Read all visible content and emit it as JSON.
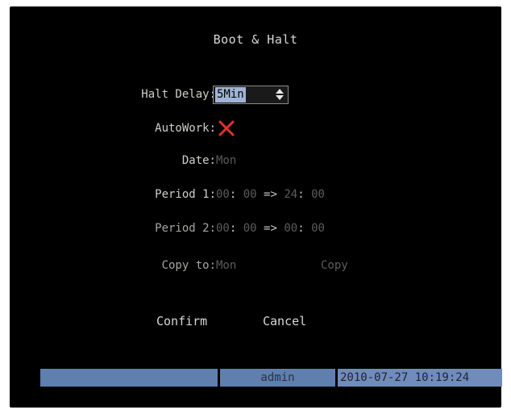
{
  "dialog": {
    "title": "Boot & Halt"
  },
  "fields": {
    "halt_delay": {
      "label": "Halt Delay:",
      "value": "5Min"
    },
    "autowork": {
      "label": "AutoWork:",
      "icon": "cross-icon",
      "color": "#e0322d"
    },
    "date": {
      "label": "Date:",
      "value": "Mon"
    },
    "period1": {
      "label": "Period 1:",
      "start_h": "00",
      "start_m": "00",
      "arrow": "=>",
      "end_h": "24",
      "end_m": "00"
    },
    "period2": {
      "label": "Period 2:",
      "start_h": "00",
      "start_m": "00",
      "arrow": "=>",
      "end_h": "00",
      "end_m": "00"
    },
    "copy_to": {
      "label": "Copy to:",
      "value": "Mon",
      "copy_label": "Copy"
    }
  },
  "buttons": {
    "confirm": "Confirm",
    "cancel": "Cancel"
  },
  "statusbar": {
    "user": "admin",
    "datetime": "2010-07-27 10:19:24",
    "color": "#5f7fae"
  }
}
